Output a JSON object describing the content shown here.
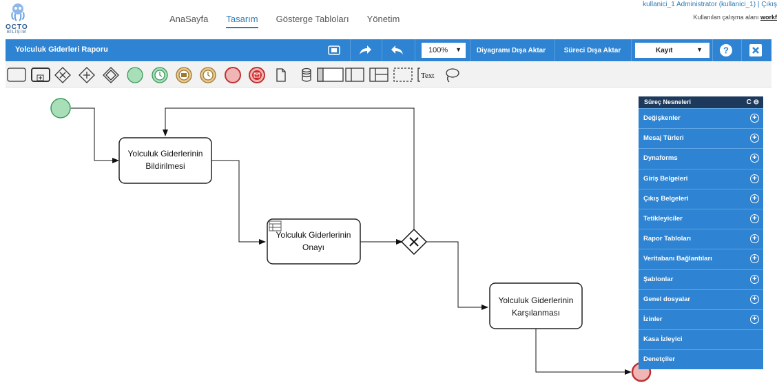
{
  "header": {
    "logo_text": "OCTO",
    "logo_sub": "BİLİŞİM",
    "nav": [
      {
        "label": "AnaSayfa"
      },
      {
        "label": "Tasarım"
      },
      {
        "label": "Gösterge Tabloları"
      },
      {
        "label": "Yönetim"
      }
    ],
    "user_line": "kullanici_1 Administrator (kullanici_1) | Çıkış",
    "workspace_prefix": "Kullanılan çalışma alanı",
    "workspace_link": "workf"
  },
  "toolbar": {
    "title": "Yolculuk Giderleri Raporu",
    "zoom": "100%",
    "export_diagram": "Diyagramı Dışa Aktar",
    "export_process": "Süreci Dışa Aktar",
    "save_select": "Kayıt",
    "help_icon": "question-circle-icon",
    "close_icon": "close-square-icon"
  },
  "shapes_palette": {
    "text_tool": "Text"
  },
  "diagram": {
    "task1": [
      "Yolculuk Giderlerinin",
      "Bildirilmesi"
    ],
    "task2": [
      "Yolculuk Giderlerinin",
      "Onayı"
    ],
    "task3": [
      "Yolculuk Giderlerinin",
      "Karşılanması"
    ]
  },
  "panel": {
    "title": "Süreç Nesneleri",
    "items": [
      {
        "label": "Değişkenler"
      },
      {
        "label": "Mesaj Türleri"
      },
      {
        "label": "Dynaforms"
      },
      {
        "label": "Giriş Belgeleri"
      },
      {
        "label": "Çıkış Belgeleri"
      },
      {
        "label": "Tetikleyiciler"
      },
      {
        "label": "Rapor Tabloları"
      },
      {
        "label": "Veritabanı Bağlantıları"
      },
      {
        "label": "Şablonlar"
      },
      {
        "label": "Genel dosyalar"
      },
      {
        "label": "İzinler"
      },
      {
        "label": "Kasa İzleyici"
      },
      {
        "label": "Denetçiler"
      }
    ]
  },
  "colors": {
    "toolbar_blue": "#2e84d3",
    "nav_active": "#2e7bb4",
    "start_event": "#a8dfb8",
    "end_event": "#f0b5b5"
  }
}
